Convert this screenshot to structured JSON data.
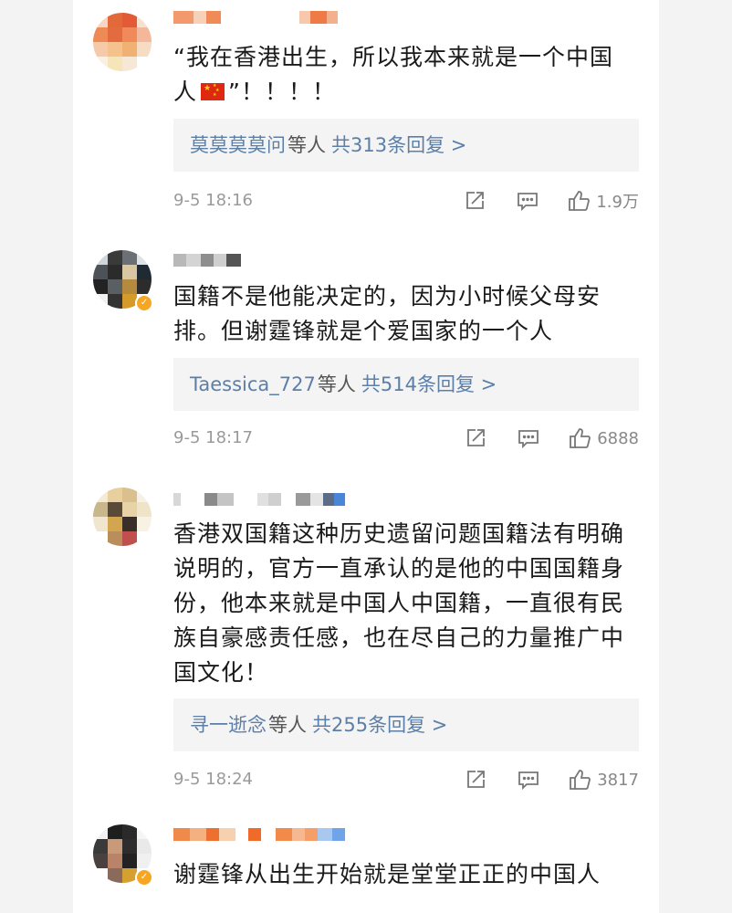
{
  "comments": [
    {
      "text_before_flag": "“我在香港出生，所以我本来就是一个中国人",
      "text_after_flag": "”！！！！",
      "flag": "china-flag-icon",
      "reply_names": "莫莫莫莫问",
      "reply_mid": "等人",
      "reply_count": "共313条回复 >",
      "time": "9-5 18:16",
      "likes": "1.9万"
    },
    {
      "text": "国籍不是他能决定的，因为小时候父母安排。但谢霆锋就是个爱国家的一个人",
      "reply_names": "Taessica_727",
      "reply_mid": "等人",
      "reply_count": "共514条回复 >",
      "time": "9-5 18:17",
      "likes": "6888"
    },
    {
      "text": "香港双国籍这种历史遗留问题国籍法有明确说明的，官方一直承认的是他的中国国籍身份，他本来就是中国人中国籍，一直很有民族自豪感责任感，也在尽自己的力量推广中国文化！",
      "reply_names": "寻一逝念",
      "reply_mid": "等人",
      "reply_count": "共255条回复 >",
      "time": "9-5 18:24",
      "likes": "3817"
    },
    {
      "text": "谢霆锋从出生开始就是堂堂正正的中国人"
    }
  ],
  "icons": {
    "share": "share-icon",
    "comment": "comment-icon",
    "like": "thumbs-up-icon",
    "verified": "verified-badge-icon"
  },
  "colors": {
    "link": "#5c7fa8",
    "meta": "#9a9a9a",
    "reply_bg": "#f4f4f4",
    "background": "#f3f3f3"
  }
}
